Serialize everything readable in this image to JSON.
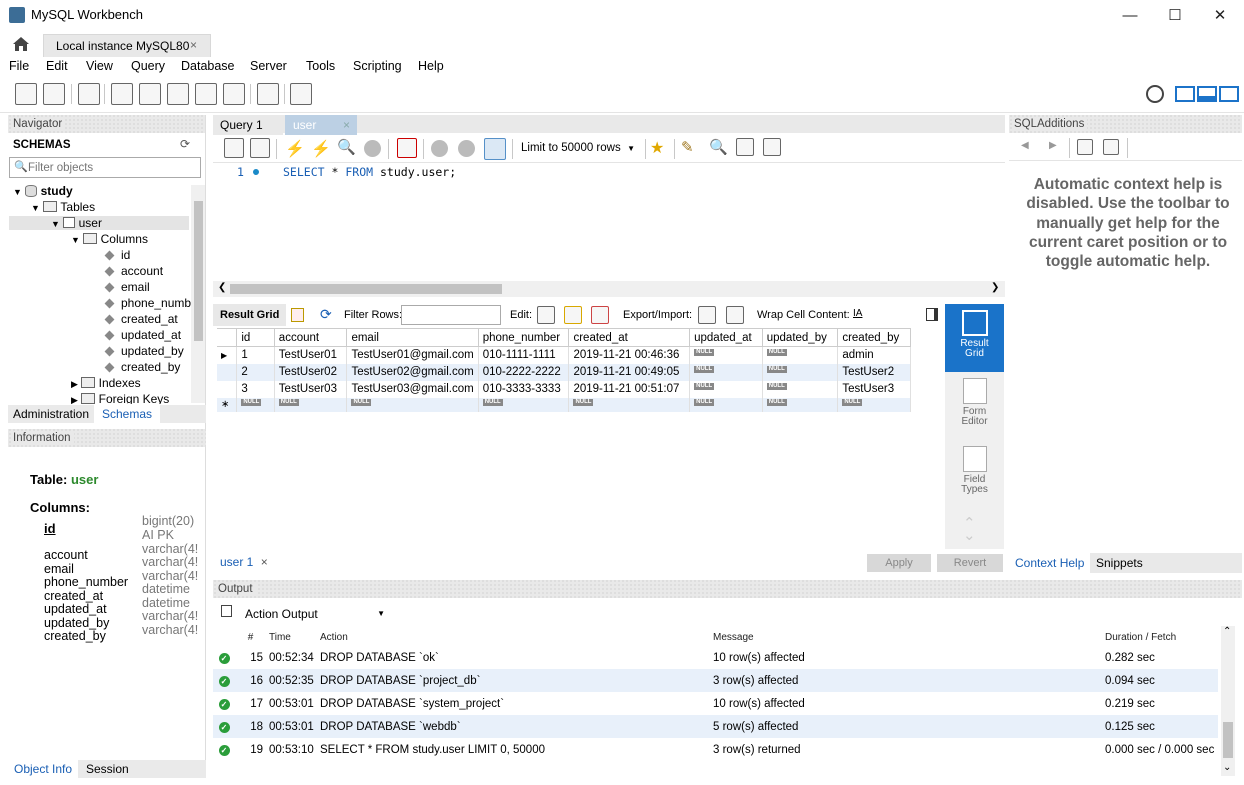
{
  "window": {
    "title": "MySQL Workbench"
  },
  "connection_tab": {
    "label": "Local instance MySQL80"
  },
  "menu": [
    "File",
    "Edit",
    "View",
    "Query",
    "Database",
    "Server",
    "Tools",
    "Scripting",
    "Help"
  ],
  "navigator": {
    "header": "Navigator",
    "schemas_label": "SCHEMAS",
    "filter_placeholder": "Filter objects",
    "tree": {
      "schema": "study",
      "tables": "Tables",
      "table": "user",
      "columns_label": "Columns",
      "columns": [
        "id",
        "account",
        "email",
        "phone_numb",
        "created_at",
        "updated_at",
        "updated_by",
        "created_by"
      ],
      "indexes": "Indexes",
      "foreign_keys": "Foreign Keys"
    },
    "tabs": {
      "administration": "Administration",
      "schemas": "Schemas"
    }
  },
  "information": {
    "header": "Information",
    "table_label": "Table:",
    "table_name": "user",
    "columns_label": "Columns:",
    "columns": [
      {
        "name": "id",
        "type": "bigint(20)",
        "extra": "AI PK"
      },
      {
        "name": "account",
        "type": "varchar(4!"
      },
      {
        "name": "email",
        "type": "varchar(4!"
      },
      {
        "name": "phone_number",
        "type": "varchar(4!"
      },
      {
        "name": "created_at",
        "type": "datetime"
      },
      {
        "name": "updated_at",
        "type": "datetime"
      },
      {
        "name": "updated_by",
        "type": "varchar(4!"
      },
      {
        "name": "created_by",
        "type": "varchar(4!"
      }
    ],
    "tabs": {
      "object_info": "Object Info",
      "session": "Session"
    }
  },
  "query_tabs": [
    "Query 1",
    "user"
  ],
  "query_toolbar": {
    "limit": "Limit to 50000 rows"
  },
  "editor": {
    "line": "1",
    "sql_kw1": "SELECT",
    "sql_star": "*",
    "sql_kw2": "FROM",
    "sql_rest": "study.user;"
  },
  "result_toolbar": {
    "result_grid": "Result Grid",
    "filter_rows": "Filter Rows:",
    "edit": "Edit:",
    "export_import": "Export/Import:",
    "wrap": "Wrap Cell Content:"
  },
  "grid": {
    "columns": [
      "id",
      "account",
      "email",
      "phone_number",
      "created_at",
      "updated_at",
      "updated_by",
      "created_by"
    ],
    "rows": [
      [
        "1",
        "TestUser01",
        "TestUser01@gmail.com",
        "010-1111-1111",
        "2019-11-21 00:46:36",
        "NULL",
        "NULL",
        "admin"
      ],
      [
        "2",
        "TestUser02",
        "TestUser02@gmail.com",
        "010-2222-2222",
        "2019-11-21 00:49:05",
        "NULL",
        "NULL",
        "TestUser2"
      ],
      [
        "3",
        "TestUser03",
        "TestUser03@gmail.com",
        "010-3333-3333",
        "2019-11-21 00:51:07",
        "NULL",
        "NULL",
        "TestUser3"
      ]
    ],
    "null_label": "NULL"
  },
  "side_panel": {
    "result_grid": "Result Grid",
    "form_editor": "Form Editor",
    "field_types": "Field Types"
  },
  "result_tab": {
    "label": "user 1",
    "apply": "Apply",
    "revert": "Revert"
  },
  "sql_additions": {
    "header": "SQLAdditions",
    "help_text": "Automatic context help is disabled. Use the toolbar to manually get help for the current caret position or to toggle automatic help.",
    "tabs": {
      "context_help": "Context Help",
      "snippets": "Snippets"
    }
  },
  "output": {
    "header": "Output",
    "selector": "Action Output",
    "columns": [
      "#",
      "Time",
      "Action",
      "Message",
      "Duration / Fetch"
    ],
    "rows": [
      [
        "15",
        "00:52:34",
        "DROP DATABASE `ok`",
        "10 row(s) affected",
        "0.282 sec"
      ],
      [
        "16",
        "00:52:35",
        "DROP DATABASE `project_db`",
        "3 row(s) affected",
        "0.094 sec"
      ],
      [
        "17",
        "00:53:01",
        "DROP DATABASE `system_project`",
        "10 row(s) affected",
        "0.219 sec"
      ],
      [
        "18",
        "00:53:01",
        "DROP DATABASE `webdb`",
        "5 row(s) affected",
        "0.125 sec"
      ],
      [
        "19",
        "00:53:10",
        "SELECT * FROM study.user LIMIT 0, 50000",
        "3 row(s) returned",
        "0.000 sec / 0.000 sec"
      ]
    ]
  }
}
